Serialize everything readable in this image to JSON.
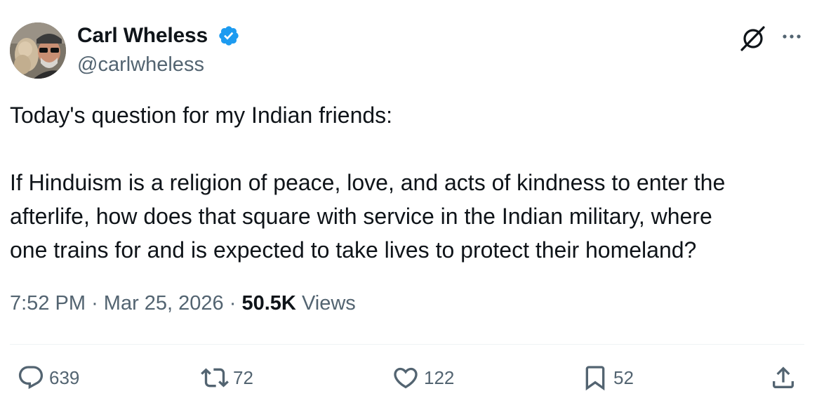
{
  "author": {
    "name": "Carl Wheless",
    "handle": "@carlwheless",
    "verified": true
  },
  "tweet": {
    "line1": "Today's question for my Indian friends:",
    "line2": "If Hinduism is a religion of peace, love, and acts of kindness to enter the",
    "line3": "afterlife, how does that square with service in the Indian military, where",
    "line4": "one trains for and is expected to take lives to protect their homeland?"
  },
  "meta": {
    "time": "7:52 PM",
    "separator": "·",
    "date": "Mar 25, 2026",
    "views_count": "50.5K",
    "views_label": "Views"
  },
  "actions": {
    "replies": "639",
    "reposts": "72",
    "likes": "122",
    "bookmarks": "52"
  },
  "icons": {
    "verified": "verified-badge-icon",
    "grok": "grok-icon",
    "more": "more-icon",
    "reply": "reply-icon",
    "repost": "repost-icon",
    "like": "heart-icon",
    "bookmark": "bookmark-icon",
    "share": "share-icon"
  },
  "colors": {
    "text": "#0f1419",
    "secondary": "#536471",
    "verified": "#1d9bf0",
    "divider": "#eff3f4"
  }
}
